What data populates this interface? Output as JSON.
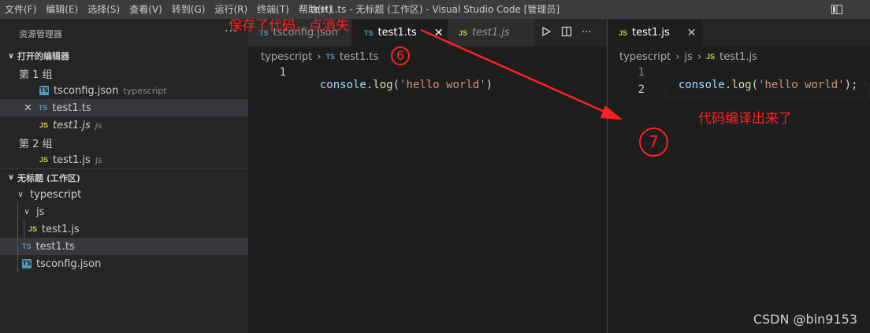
{
  "menubar": {
    "items": [
      "文件(F)",
      "编辑(E)",
      "选择(S)",
      "查看(V)",
      "转到(G)",
      "运行(R)",
      "终端(T)",
      "帮助(H)"
    ]
  },
  "window_title": "test1.ts - 无标题 (工作区) - Visual Studio Code [管理员]",
  "sidebar": {
    "title": "资源管理器",
    "more": "···",
    "open_editors": {
      "header": "打开的编辑器",
      "group1_label": "第 1 组",
      "group2_label": "第 2 组",
      "items": [
        {
          "badge": "TS",
          "name": "tsconfig.json",
          "desc": "typescript",
          "icon": "json-file-icon"
        },
        {
          "badge": "TS",
          "name": "test1.ts",
          "desc": "",
          "icon": "ts-file-icon"
        },
        {
          "badge": "JS",
          "name": "test1.js",
          "desc": "js",
          "icon": "js-file-icon"
        },
        {
          "badge": "JS",
          "name": "test1.js",
          "desc": "js",
          "icon": "js-file-icon"
        }
      ],
      "close_glyph": "✕"
    },
    "workspace": {
      "header": "无标题 (工作区)",
      "folder_typescript": "typescript",
      "folder_js": "js",
      "file_js": "test1.js",
      "file_ts": "test1.ts",
      "file_json": "tsconfig.json"
    }
  },
  "editor1": {
    "tabs": [
      {
        "badge": "TS",
        "label": "tsconfig.json",
        "active": false
      },
      {
        "badge": "TS",
        "label": "test1.ts",
        "active": true
      },
      {
        "badge": "JS",
        "label": "test1.js",
        "active": false
      }
    ],
    "close_glyph": "✕",
    "actions": [
      "run-icon",
      "split-editor-icon",
      "more-actions-icon"
    ],
    "more_glyph": "···",
    "breadcrumb": [
      "typescript",
      "test1.ts"
    ],
    "lines": [
      {
        "num": "1",
        "tokens": [
          {
            "t": "console",
            "c": "obj"
          },
          {
            "t": ".",
            "c": "punc"
          },
          {
            "t": "log",
            "c": "fn"
          },
          {
            "t": "(",
            "c": "punc"
          },
          {
            "t": "'hello world'",
            "c": "str"
          },
          {
            "t": ")",
            "c": "punc"
          }
        ]
      }
    ]
  },
  "editor2": {
    "tab": {
      "badge": "JS",
      "label": "test1.js"
    },
    "close_glyph": "✕",
    "breadcrumb": [
      "typescript",
      "js",
      "test1.js"
    ],
    "lines": [
      {
        "num": "1",
        "tokens": [
          {
            "t": "console",
            "c": "obj"
          },
          {
            "t": ".",
            "c": "punc"
          },
          {
            "t": "log",
            "c": "fn"
          },
          {
            "t": "(",
            "c": "punc"
          },
          {
            "t": "'hello world'",
            "c": "str"
          },
          {
            "t": ");",
            "c": "punc"
          }
        ]
      },
      {
        "num": "2",
        "tokens": []
      }
    ]
  },
  "annotations": {
    "save_text": "保存了代码，点消失",
    "compiled_text": "代码编译出来了",
    "step6": "6",
    "step7": "7",
    "color": "#ff2020"
  },
  "watermark": "CSDN @bin9153"
}
